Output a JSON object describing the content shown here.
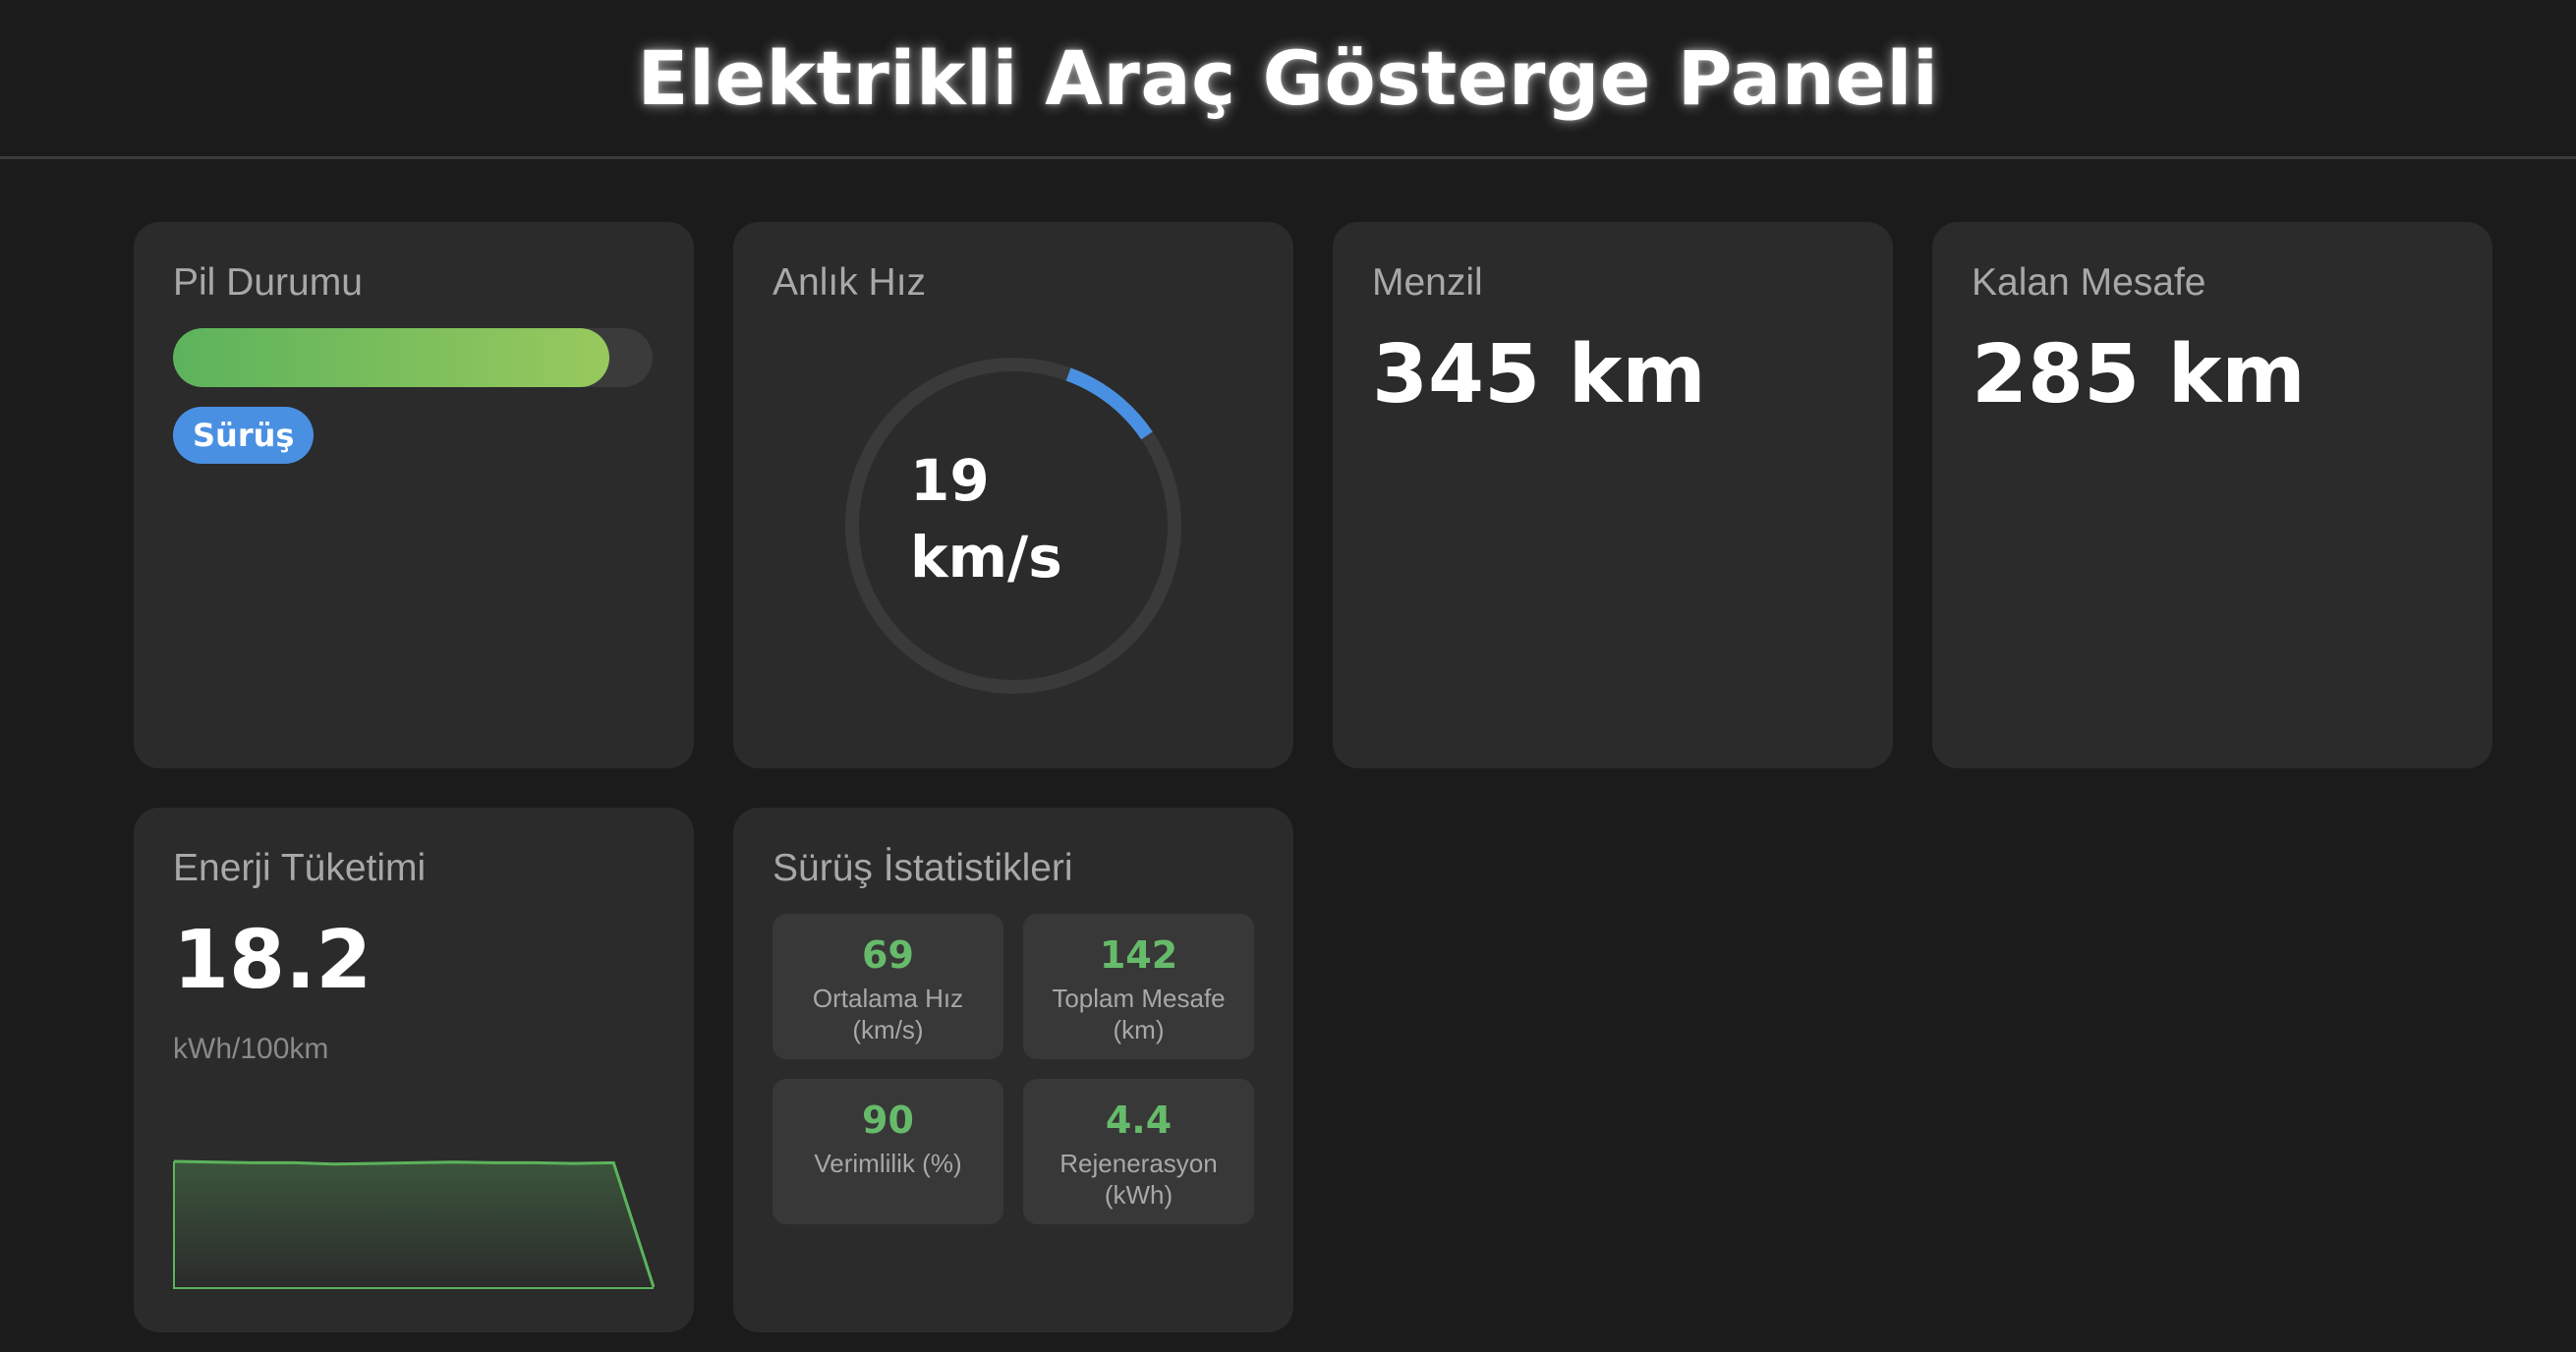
{
  "header": {
    "title": "Elektrikli Araç Gösterge Paneli"
  },
  "battery": {
    "title": "Pil Durumu",
    "level_fraction": 0.91,
    "mode_badge": "Sürüş"
  },
  "speed": {
    "title": "Anlık Hız",
    "value": "19",
    "unit": "km/s",
    "gauge_fraction": 0.1
  },
  "range": {
    "title": "Menzil",
    "value": "345 km"
  },
  "remaining": {
    "title": "Kalan Mesafe",
    "value": "285 km"
  },
  "energy": {
    "title": "Enerji Tüketimi",
    "value": "18.2",
    "unit": "kWh/100km",
    "trend": [
      18.2,
      18.1,
      18.0,
      18.0,
      17.8,
      17.9,
      18.0,
      18.1,
      18.0,
      18.0,
      17.9,
      18.0,
      0
    ]
  },
  "stats": {
    "title": "Sürüş İstatistikleri",
    "items": [
      {
        "value": "69",
        "label": "Ortalama Hız (km/s)"
      },
      {
        "value": "142",
        "label": "Toplam Mesafe (km)"
      },
      {
        "value": "90",
        "label": "Verimlilik (%)"
      },
      {
        "value": "4.4",
        "label": "Rejenerasyon (kWh)"
      }
    ]
  },
  "colors": {
    "accent_blue": "#4a90e2",
    "accent_green": "#66bb6a",
    "card_bg": "#2b2b2b",
    "page_bg": "#1b1b1b"
  }
}
